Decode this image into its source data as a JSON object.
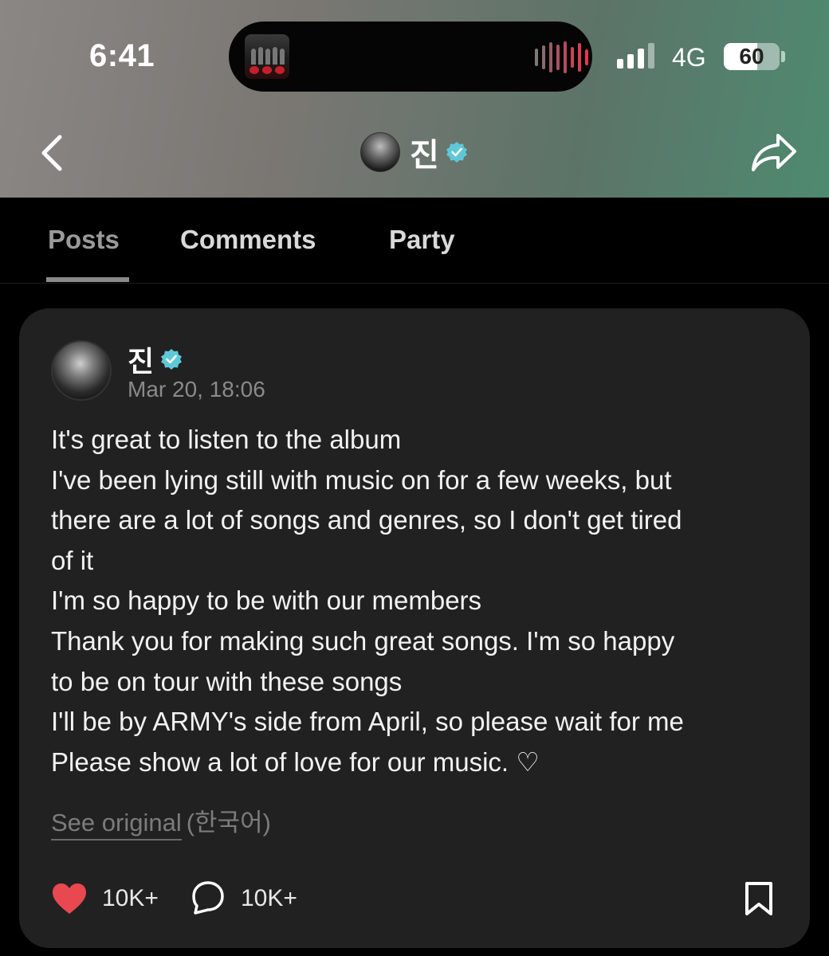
{
  "status_bar": {
    "time": "6:41",
    "network": "4G",
    "battery": "60",
    "battery_level": 0.6
  },
  "header": {
    "back_icon": "chevron-left-icon",
    "share_icon": "share-arrow-icon",
    "profile_name": "진",
    "verified_color": "#5ec8d8"
  },
  "tabs": [
    {
      "label": "Posts",
      "active": true
    },
    {
      "label": "Comments",
      "active": false
    },
    {
      "label": "Party",
      "active": false
    }
  ],
  "post": {
    "author": "진",
    "timestamp": "Mar 20, 18:06",
    "lines": [
      "It's great to listen to the album",
      "I've been lying still with music on for a few weeks, but",
      "there are a lot of songs and genres, so I don't get tired",
      "of it",
      "I'm so happy to be with our members",
      "Thank you for making such great songs. I'm so happy",
      "to be on tour with these songs",
      "I'll be by ARMY's side from April, so please wait for me",
      "Please show a lot of love for our music. ♡"
    ],
    "see_original": "See original",
    "original_language": "(한국어)",
    "like_count": "10K+",
    "comment_count": "10K+",
    "like_color": "#e8484f"
  }
}
